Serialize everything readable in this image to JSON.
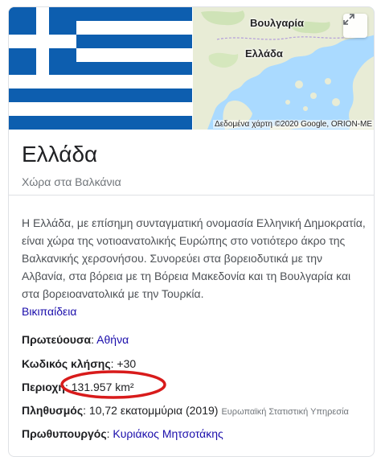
{
  "media": {
    "flag_icon": "greek-flag",
    "map": {
      "label_bulgaria": "Βουλγαρία",
      "label_greece": "Ελλάδα",
      "attribution": "Δεδομένα χάρτη ©2020 Google, ORION-ME",
      "expand_icon": "expand-icon"
    }
  },
  "entity": {
    "title": "Ελλάδα",
    "subtitle": "Χώρα στα Βαλκάνια"
  },
  "description": {
    "text": "Η Ελλάδα, με επίσημη συνταγματική ονομασία Ελληνική Δημοκρατία, είναι χώρα της νοτιοανατολικής Ευρώπης στο νοτιότερο άκρο της Βαλκανικής χερσονήσου. Συνορεύει στα βορειοδυτικά με την Αλβανία, στα βόρεια με τη Βόρεια Μακεδονία και τη Βουλγαρία και στα βορειοανατολικά με την Τουρκία.",
    "source": "Βικιπαίδεια"
  },
  "facts": {
    "capital": {
      "label": "Πρωτεύουσα",
      "sep": ": ",
      "value": "Αθήνα"
    },
    "calling_code": {
      "label": "Κωδικός κλήσης",
      "sep": ": ",
      "value": "+30"
    },
    "area": {
      "label": "Περιοχή",
      "sep": ": ",
      "value": "131.957 km²"
    },
    "population": {
      "label": "Πληθυσμός",
      "sep": ": ",
      "value": "10,72 εκατομμύρια (2019)",
      "note": "Ευρωπαϊκή Στατιστική Υπηρεσία"
    },
    "prime_minister": {
      "label": "Πρωθυπουργός",
      "sep": ": ",
      "value": "Κυριάκος Μητσοτάκης"
    }
  },
  "colors": {
    "link": "#1a0dab",
    "flag_blue": "#0d5eaf",
    "annotation_red": "#d81b1b",
    "map_sea": "#aadaff",
    "map_land": "#e8ecd6"
  }
}
